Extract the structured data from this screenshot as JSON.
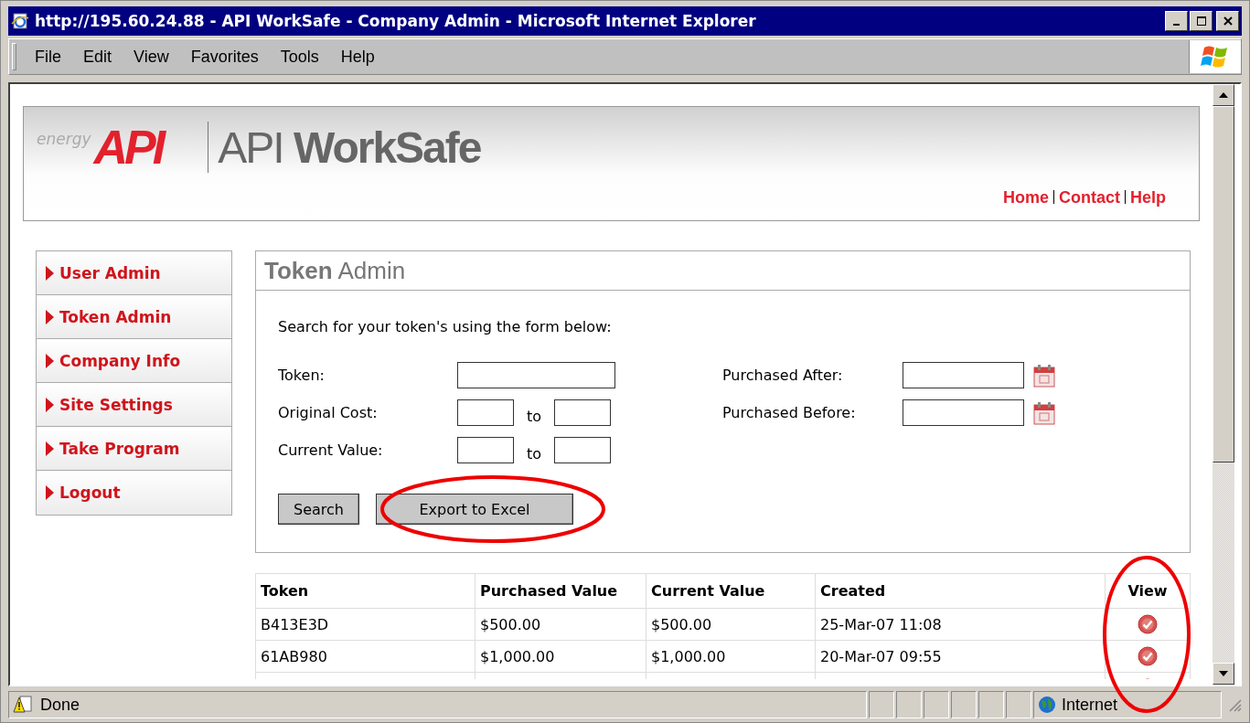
{
  "window": {
    "title": "http://195.60.24.88 - API WorkSafe - Company Admin - Microsoft Internet Explorer"
  },
  "menu": [
    "File",
    "Edit",
    "View",
    "Favorites",
    "Tools",
    "Help"
  ],
  "header": {
    "logo_tagline": "energy",
    "logo_mark": "API",
    "site_title": "API **WorkSafe**",
    "links": [
      "Home",
      "Contact",
      "Help"
    ]
  },
  "sidebar": {
    "items": [
      {
        "label": "User Admin"
      },
      {
        "label": "Token Admin"
      },
      {
        "label": "Company Info"
      },
      {
        "label": "Site Settings"
      },
      {
        "label": "Take Program"
      },
      {
        "label": "Logout"
      }
    ]
  },
  "panel": {
    "title": "**Token** Admin",
    "intro": "Search for your token's using the form below:",
    "fields_left": [
      {
        "kind": "single",
        "label": "Token:"
      },
      {
        "kind": "range",
        "label": "Original Cost:",
        "separator": "to"
      },
      {
        "kind": "range",
        "label": "Current Value:",
        "separator": "to"
      }
    ],
    "fields_right": [
      {
        "kind": "date",
        "label": "Purchased After:"
      },
      {
        "kind": "date",
        "label": "Purchased Before:"
      }
    ],
    "buttons": [
      "Search",
      "Export to Excel"
    ]
  },
  "table": {
    "columns": [
      "Token",
      "Purchased Value",
      "Current Value",
      "Created",
      "View"
    ],
    "rows": [
      {
        "token": "B413E3D",
        "purchased": "$500.00",
        "current": "$500.00",
        "created": "25-Mar-07 11:08"
      },
      {
        "token": "61AB980",
        "purchased": "$1,000.00",
        "current": "$1,000.00",
        "created": "20-Mar-07 09:55"
      }
    ]
  },
  "status_bar": {
    "text": "Done",
    "zone": "Internet"
  }
}
